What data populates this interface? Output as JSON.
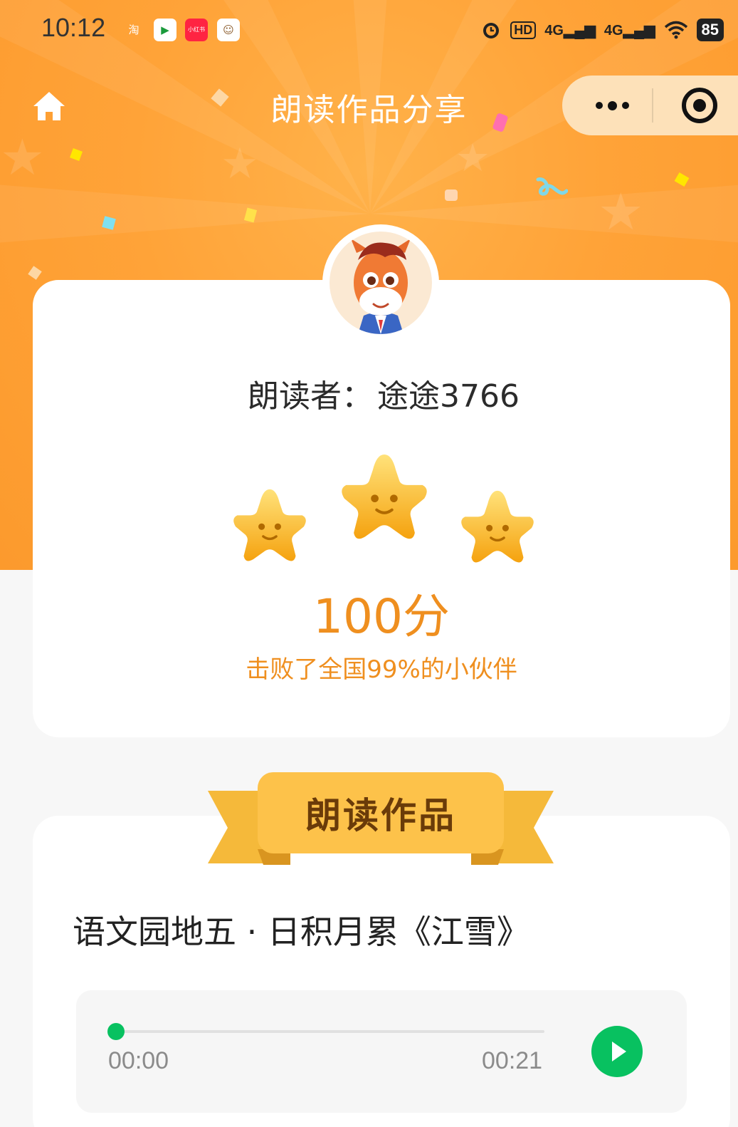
{
  "status_bar": {
    "time": "10:12",
    "apps": [
      {
        "label": "淘",
        "color": "#ff5000"
      },
      {
        "label": "▶",
        "color": "#1a9a3c"
      },
      {
        "label": "小红书",
        "color": "#ff2442"
      },
      {
        "label": "☺",
        "color": "#ffffff"
      }
    ],
    "alarm_icon": "alarm-icon",
    "hd_label": "HD",
    "net_1": "4G",
    "net_2": "4G",
    "battery": "85"
  },
  "nav": {
    "title": "朗读作品分享",
    "home_icon": "home-icon",
    "more_icon": "more-icon",
    "close_icon": "target-icon"
  },
  "reader": {
    "label": "朗读者：",
    "name": "途途3766"
  },
  "result": {
    "stars": 3,
    "max_stars": 3,
    "score_text": "100分",
    "beat_text": "击败了全国99%的小伙伴"
  },
  "works": {
    "section_title": "朗读作品",
    "poem_title": "语文园地五 · 日积月累《江雪》"
  },
  "player": {
    "current_time": "00:00",
    "total_time": "00:21",
    "progress": 0,
    "play_icon": "play-icon"
  },
  "colors": {
    "orange": "#ffa338",
    "score_orange": "#ef8f1f",
    "green": "#08c160"
  }
}
